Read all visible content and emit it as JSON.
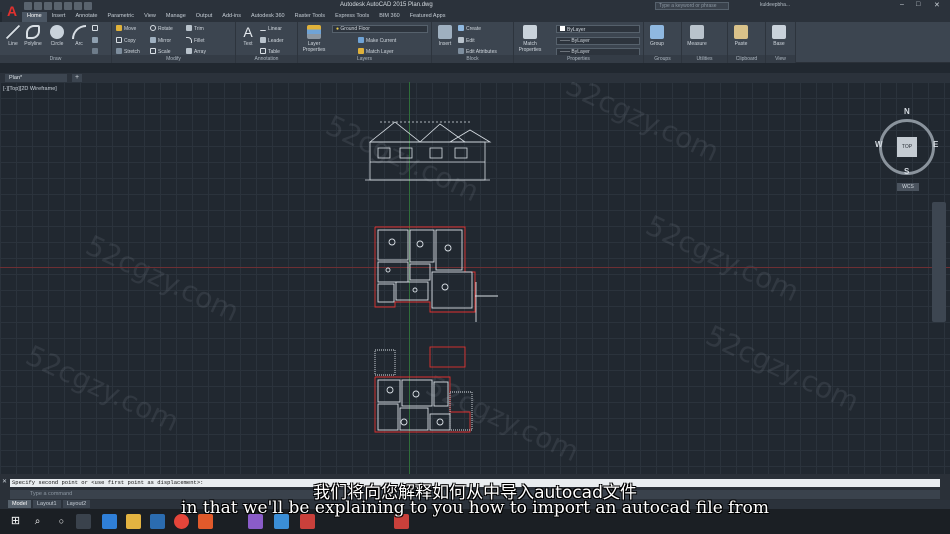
{
  "window": {
    "title": "Autodesk AutoCAD 2015   Plan.dwg",
    "search_placeholder": "Type a keyword or phrase",
    "user": "kuldeepbha..."
  },
  "ribbon_tabs": [
    "Home",
    "Insert",
    "Annotate",
    "Parametric",
    "View",
    "Manage",
    "Output",
    "Add-ins",
    "Autodesk 360",
    "Raster Tools",
    "Express Tools",
    "BIM 360",
    "Featured Apps"
  ],
  "panels": {
    "draw": {
      "title": "Draw",
      "tools": [
        "Line",
        "Polyline",
        "Circle",
        "Arc"
      ]
    },
    "modify": {
      "title": "Modify",
      "tools": [
        "Move",
        "Rotate",
        "Trim",
        "Copy",
        "Mirror",
        "Fillet",
        "Stretch",
        "Scale",
        "Array"
      ]
    },
    "annotation": {
      "title": "Annotation",
      "tools": [
        "Text",
        "Linear",
        "Leader",
        "Table"
      ]
    },
    "layers": {
      "title": "Layers",
      "tools": [
        "Layer Properties",
        "Make Current",
        "Match Layer"
      ],
      "current_layer": "Ground Floor"
    },
    "block": {
      "title": "Block",
      "tools": [
        "Insert",
        "Create",
        "Edit",
        "Edit Attributes"
      ]
    },
    "properties": {
      "title": "Properties",
      "tools": [
        "Match Properties"
      ],
      "color": "ByLayer",
      "linetype": "ByLayer",
      "lineweight": "ByLayer"
    },
    "groups": {
      "title": "Groups",
      "tools": [
        "Group"
      ]
    },
    "utilities": {
      "title": "Utilities",
      "tools": [
        "Measure"
      ]
    },
    "clipboard": {
      "title": "Clipboard",
      "tools": [
        "Paste"
      ]
    },
    "view": {
      "title": "View",
      "tools": [
        "Base"
      ]
    }
  },
  "document_tab": "Plan*",
  "viewport_label": "[-][Top][2D Wireframe]",
  "viewcube": {
    "top": "TOP",
    "n": "N",
    "s": "S",
    "e": "E",
    "w": "W",
    "wcs": "WCS"
  },
  "command": {
    "history": "Specify second point or <use first point as displacement>:",
    "input_placeholder": "Type a command"
  },
  "layout_tabs": [
    "Model",
    "Layout1",
    "Layout2"
  ],
  "watermark": "52cgzy.com",
  "subtitles": {
    "chinese": "我们将向您解释如何从中导入autocad文件",
    "english": "in that we'll be explaining to you how to import an autocad file from"
  }
}
